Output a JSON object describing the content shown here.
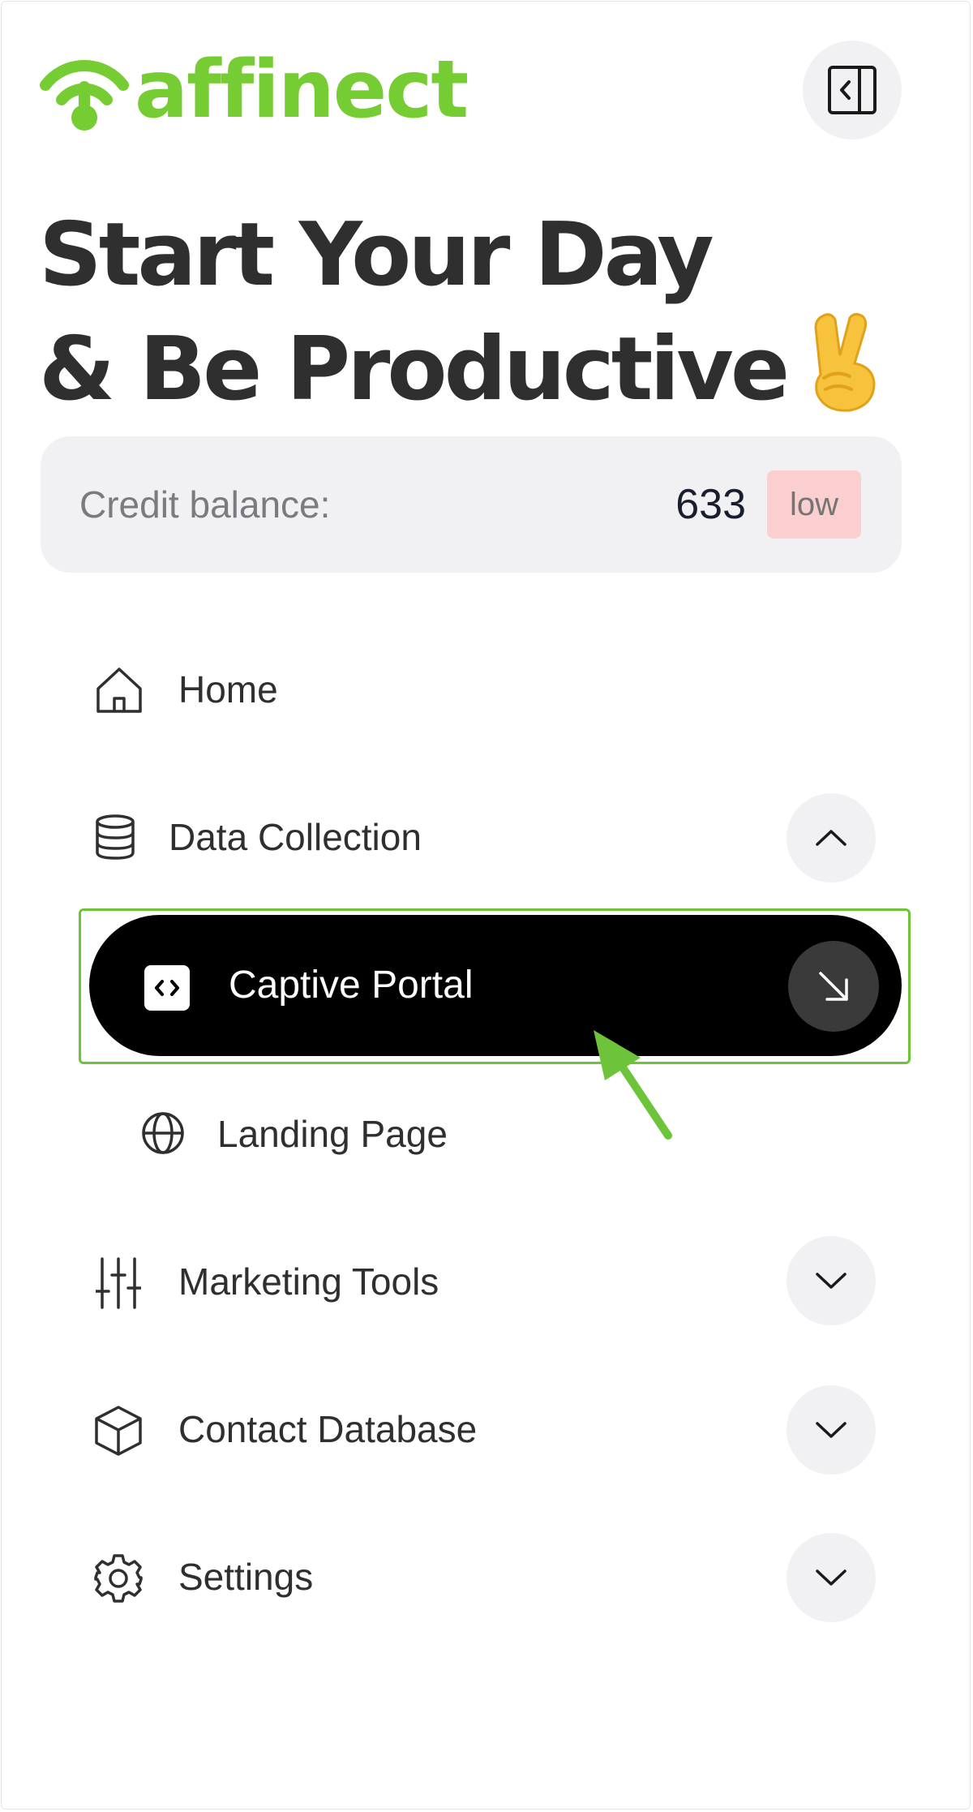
{
  "brand": {
    "name": "affinect",
    "color": "#76cc33"
  },
  "header": {
    "collapse_icon": "sidebar-collapse-icon"
  },
  "heading": {
    "line1": "Start Your Day",
    "line2": "& Be Productive",
    "emoji": "victory-hand-emoji"
  },
  "credit": {
    "label": "Credit balance:",
    "value": "633",
    "status": "low",
    "status_color": "#fbcfcf"
  },
  "nav": {
    "home": {
      "label": "Home",
      "icon": "home-icon"
    },
    "data_collection": {
      "label": "Data Collection",
      "icon": "database-icon",
      "expanded": true,
      "children": {
        "captive_portal": {
          "label": "Captive Portal",
          "icon": "code-icon",
          "active": true
        },
        "landing_page": {
          "label": "Landing Page",
          "icon": "globe-icon"
        }
      }
    },
    "marketing_tools": {
      "label": "Marketing Tools",
      "icon": "sliders-icon",
      "expanded": false
    },
    "contact_database": {
      "label": "Contact Database",
      "icon": "cube-icon",
      "expanded": false
    },
    "settings": {
      "label": "Settings",
      "icon": "gear-icon",
      "expanded": false
    }
  },
  "annotation": {
    "arrow_color": "#6dc43a",
    "highlight_color": "#6dc43a"
  }
}
